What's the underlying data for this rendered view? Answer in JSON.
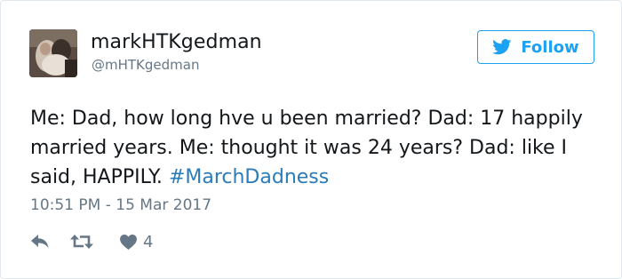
{
  "user": {
    "display_name": "markHTKgedman",
    "handle": "@mHTKgedman"
  },
  "follow_button": {
    "label": "Follow",
    "icon": "twitter-bird-icon"
  },
  "tweet": {
    "text": "Me: Dad, how long hve u been married? Dad: 17 happily married years. Me: thought it was 24 years? Dad: like I said, HAPPILY.",
    "hashtag": "#MarchDadness",
    "timestamp": "10:51 PM - 15 Mar 2017"
  },
  "actions": {
    "reply_icon": "reply-icon",
    "retweet_icon": "retweet-icon",
    "like_icon": "heart-icon",
    "like_count": "4"
  },
  "colors": {
    "accent": "#1da1f2",
    "hashtag": "#2b7bb9",
    "text": "#14171a",
    "muted": "#657786",
    "border": "#e1e8ed"
  }
}
